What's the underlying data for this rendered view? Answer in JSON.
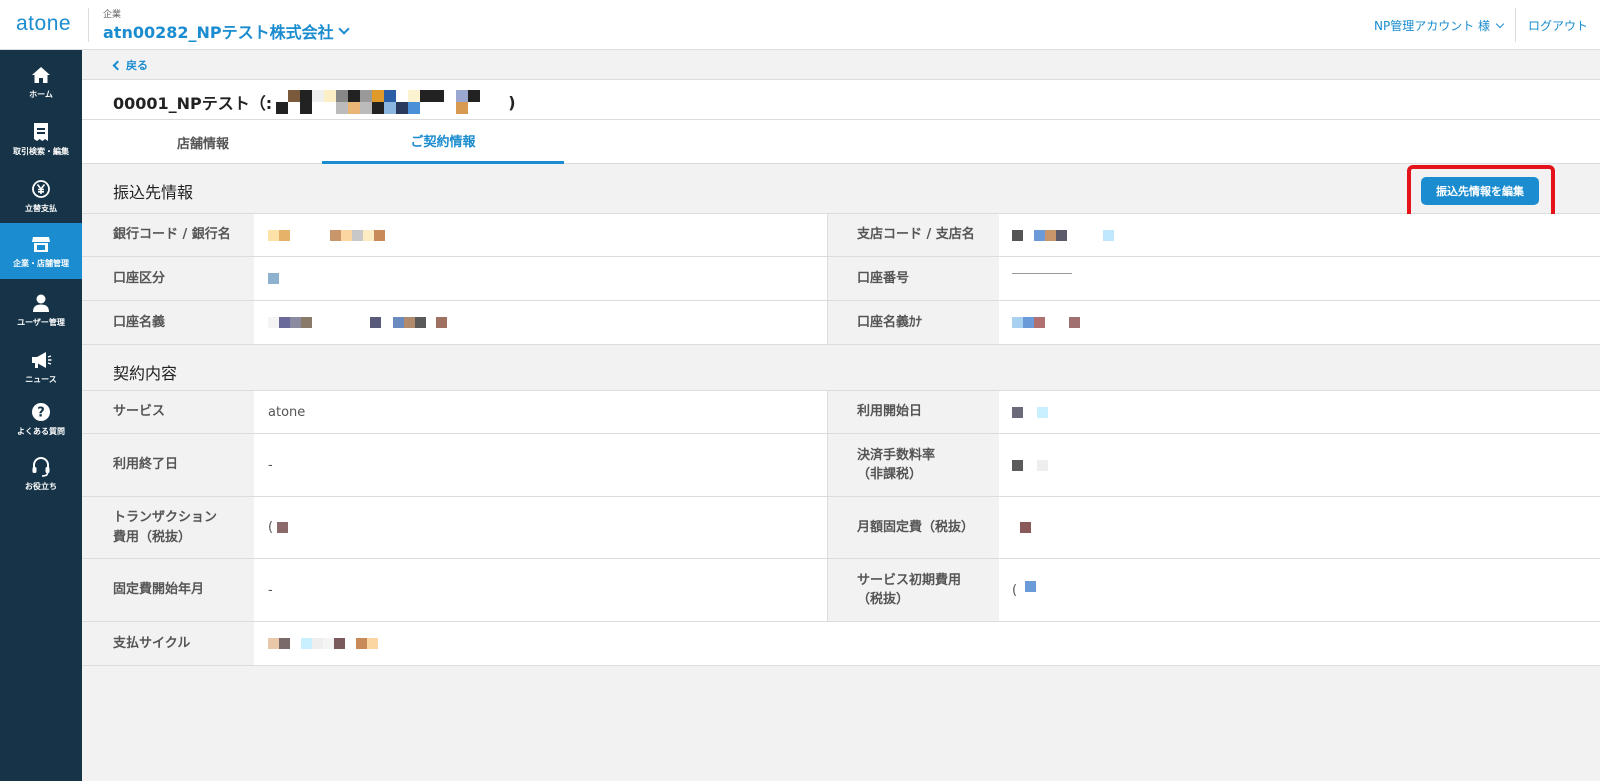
{
  "header": {
    "logo": "atone",
    "company_label": "企業",
    "company_name": "atn00282_NPテスト株式会社",
    "account": "NP管理アカウント 様",
    "logout": "ログアウト"
  },
  "sidebar": {
    "items": [
      {
        "label": "ホーム",
        "icon": "home-icon"
      },
      {
        "label": "取引検索・編集",
        "icon": "receipt-icon"
      },
      {
        "label": "立替支払",
        "icon": "yen-icon"
      },
      {
        "label": "企業・店舗管理",
        "icon": "store-icon",
        "active": true
      },
      {
        "label": "ユーザー管理",
        "icon": "user-icon"
      },
      {
        "label": "ニュース",
        "icon": "megaphone-icon"
      },
      {
        "label": "よくある質問",
        "icon": "question-icon"
      },
      {
        "label": "お役立ち",
        "icon": "headset-icon"
      }
    ]
  },
  "main": {
    "back": "戻る",
    "store_title_prefix": "00001_NPテスト（:",
    "store_title_suffix": ")",
    "tabs": [
      "店舗情報",
      "ご契約情報"
    ],
    "active_tab": 1,
    "bank_section": {
      "title": "振込先情報",
      "edit_button": "振込先情報を編集",
      "rows": [
        {
          "left_label": "銀行コード / 銀行名",
          "right_label": "支店コード / 支店名"
        },
        {
          "left_label": "口座区分",
          "right_label": "口座番号"
        },
        {
          "left_label": "口座名義",
          "right_label": "口座名義ｶﾅ"
        }
      ]
    },
    "contract_section": {
      "title": "契約内容",
      "rows": [
        {
          "left_label": "サービス",
          "left_value": "atone",
          "right_label": "利用開始日",
          "right_value": ""
        },
        {
          "left_label": "利用終了日",
          "left_value": "-",
          "right_label": "決済手数料率\n（非課税）",
          "right_value": ""
        },
        {
          "left_label": "トランザクション\n費用（税抜）",
          "left_value": "(",
          "right_label": "月額固定費（税抜）",
          "right_value": ""
        },
        {
          "left_label": "固定費開始年月",
          "left_value": "-",
          "right_label": "サービス初期費用\n（税抜）",
          "right_value": "("
        },
        {
          "left_label": "支払サイクル",
          "left_value": ""
        }
      ]
    }
  },
  "colors": {
    "accent": "#1a8ccf",
    "sidebar": "#163347",
    "highlight": "#e3121b"
  }
}
